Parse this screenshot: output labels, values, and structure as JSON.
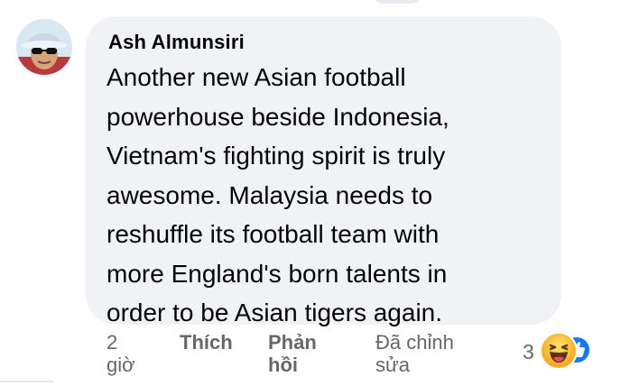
{
  "comment": {
    "author": "Ash Almunsiri",
    "text": "Another new Asian football\npowerhouse beside Indonesia,\nVietnam's fighting spirit is truly\nawesome. Malaysia needs to\nreshuffle its football team with\nmore England's born talents in\norder to be Asian tigers again.",
    "avatar_icon": "user-avatar-photo"
  },
  "actions": {
    "time": "2\ngiờ",
    "like_label": "Thích",
    "reply_label": "Phản\nhồi",
    "edited_label": "Đã chỉnh\nsửa"
  },
  "reactions": {
    "count": "3",
    "icons": [
      "haha-reaction-icon",
      "like-reaction-icon"
    ],
    "colors": {
      "like": "#1877f2",
      "haha": "#f7b125"
    }
  },
  "colors": {
    "bubble": "#f0f2f5",
    "text": "#050505",
    "secondary_text": "#65676b"
  }
}
